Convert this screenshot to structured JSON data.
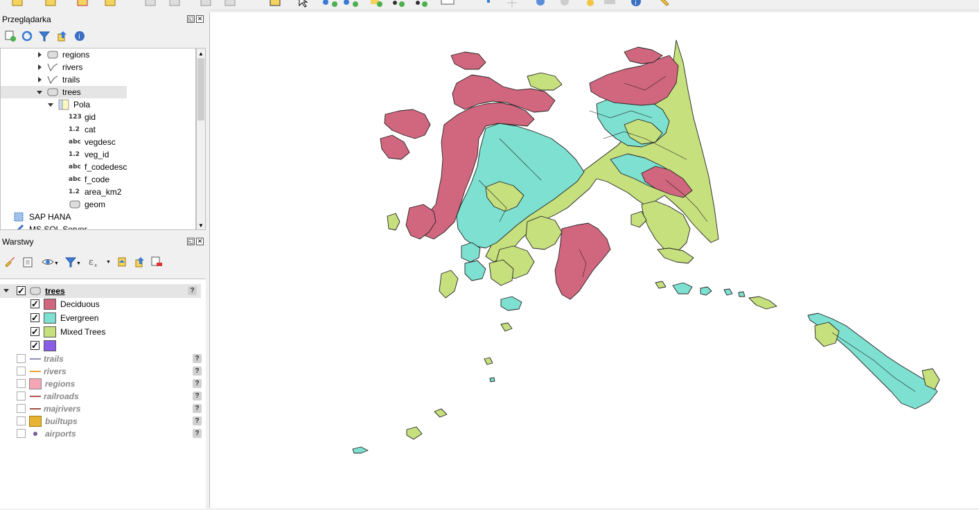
{
  "browser_panel": {
    "title": "Przeglądarka",
    "tree": [
      {
        "label": "regions",
        "type": "polygon",
        "expanded": false
      },
      {
        "label": "rivers",
        "type": "line",
        "expanded": false
      },
      {
        "label": "trails",
        "type": "line",
        "expanded": false
      },
      {
        "label": "trees",
        "type": "polygon",
        "expanded": true,
        "selected": true
      },
      {
        "label": "Pola",
        "type": "fields",
        "expanded": true
      },
      {
        "label": "gid",
        "type_tag": "123"
      },
      {
        "label": "cat",
        "type_tag": "1.2"
      },
      {
        "label": "vegdesc",
        "type_tag": "abc"
      },
      {
        "label": "veg_id",
        "type_tag": "1.2"
      },
      {
        "label": "f_codedesc",
        "type_tag": "abc"
      },
      {
        "label": "f_code",
        "type_tag": "abc"
      },
      {
        "label": "area_km2",
        "type_tag": "1.2"
      },
      {
        "label": "geom",
        "type": "polygon"
      },
      {
        "label": "SAP HANA",
        "type": "db"
      },
      {
        "label": "MS SQL Server",
        "type": "db"
      }
    ]
  },
  "layers_panel": {
    "title": "Warstwy",
    "layers": [
      {
        "name": "trees",
        "checked": true,
        "active": true
      },
      {
        "name": "trails",
        "checked": false,
        "symbol": "line",
        "color": "#8c8cb4"
      },
      {
        "name": "rivers",
        "checked": false,
        "symbol": "line",
        "color": "#f0a030"
      },
      {
        "name": "regions",
        "checked": false,
        "symbol": "fill",
        "color": "#f4a6b4"
      },
      {
        "name": "railroads",
        "checked": false,
        "symbol": "line",
        "color": "#b45050"
      },
      {
        "name": "majrivers",
        "checked": false,
        "symbol": "line",
        "color": "#a05040"
      },
      {
        "name": "builtups",
        "checked": false,
        "symbol": "fill",
        "color": "#e6b432"
      },
      {
        "name": "airports",
        "checked": false,
        "symbol": "point",
        "color": "#7a5a9a"
      }
    ],
    "trees_classes": [
      {
        "label": "Deciduous",
        "color": "#d1677e",
        "checked": true
      },
      {
        "label": "Evergreen",
        "color": "#7de0d0",
        "checked": true
      },
      {
        "label": "Mixed Trees",
        "color": "#c6e07e",
        "checked": true
      },
      {
        "label": "",
        "color": "#8a5ce8",
        "checked": true
      }
    ]
  },
  "map": {
    "colors": {
      "deciduous": "#d1677e",
      "evergreen": "#7de0d0",
      "mixed": "#c6e07e",
      "outline": "#222222"
    }
  }
}
